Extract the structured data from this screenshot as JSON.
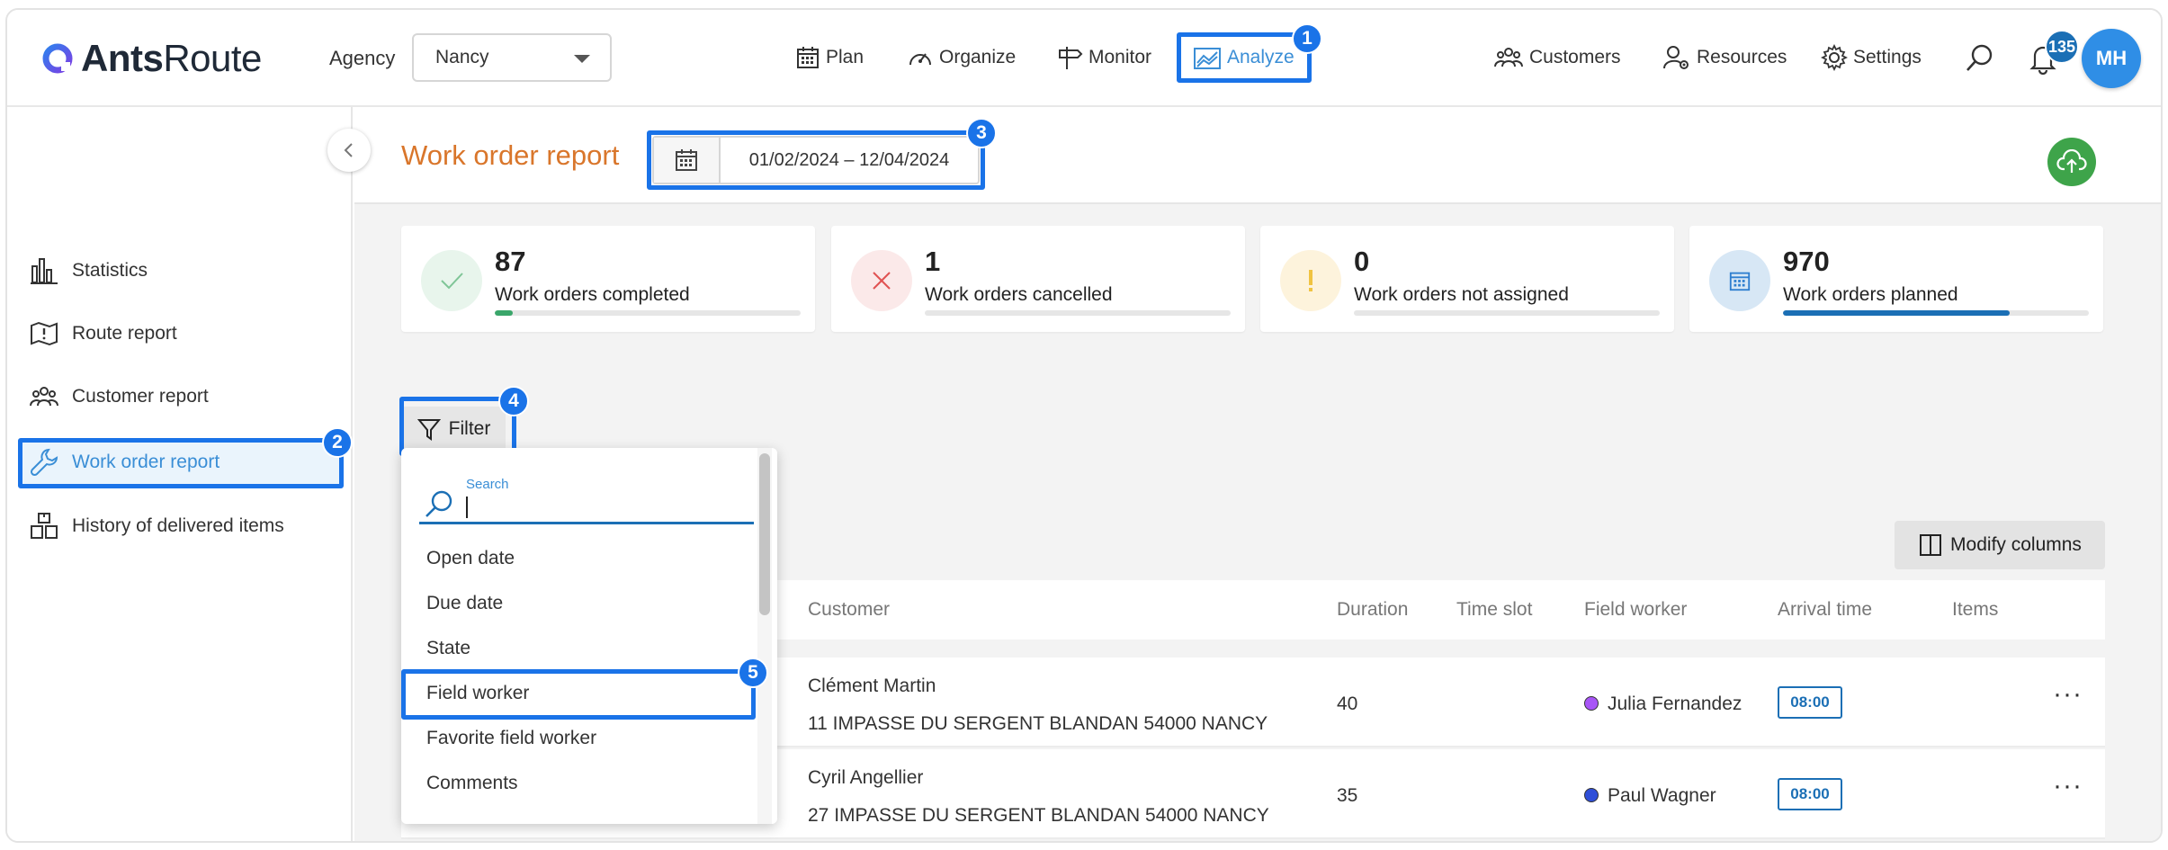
{
  "app": {
    "logo_text_bold": "Ants",
    "logo_text_light": "Route"
  },
  "header": {
    "agency_label": "Agency",
    "agency_value": "Nancy",
    "nav": [
      {
        "label": "Plan",
        "icon": "calendar-icon"
      },
      {
        "label": "Organize",
        "icon": "gauge-icon"
      },
      {
        "label": "Monitor",
        "icon": "signpost-icon"
      },
      {
        "label": "Analyze",
        "icon": "chart-icon",
        "active": true
      }
    ],
    "right_nav": [
      {
        "label": "Customers",
        "icon": "people-icon"
      },
      {
        "label": "Resources",
        "icon": "user-gear-icon"
      },
      {
        "label": "Settings",
        "icon": "gear-icon"
      }
    ],
    "notifications_count": "135",
    "avatar_initials": "MH"
  },
  "sidebar": {
    "items": [
      {
        "label": "Statistics",
        "icon": "bar-chart-icon"
      },
      {
        "label": "Route report",
        "icon": "route-icon"
      },
      {
        "label": "Customer report",
        "icon": "people-icon"
      },
      {
        "label": "Work order report",
        "icon": "wrench-icon",
        "active": true
      },
      {
        "label": "History of delivered items",
        "icon": "boxes-icon"
      }
    ]
  },
  "page": {
    "title": "Work order report",
    "date_range": "01/02/2024 – 12/04/2024"
  },
  "stats": [
    {
      "value": "87",
      "label": "Work orders completed",
      "fill": 0.06,
      "color": "#3aa66a"
    },
    {
      "value": "1",
      "label": "Work orders cancelled",
      "fill": 0.0,
      "color": "#e05252"
    },
    {
      "value": "0",
      "label": "Work orders not assigned",
      "fill": 0.0,
      "color": "#e8b23a"
    },
    {
      "value": "970",
      "label": "Work orders planned",
      "fill": 0.74,
      "color": "#1b6fb5"
    }
  ],
  "toolbar": {
    "filter_label": "Filter",
    "modify_columns_label": "Modify columns"
  },
  "filter_dropdown": {
    "search_label": "Search",
    "items": [
      "Open date",
      "Due date",
      "State",
      "Field worker",
      "Favorite field worker",
      "Comments"
    ]
  },
  "table": {
    "headers": [
      "Customer",
      "Duration",
      "Time slot",
      "Field worker",
      "Arrival time",
      "Items"
    ],
    "rows": [
      {
        "customer": "Clément Martin",
        "address": "11 IMPASSE DU SERGENT BLANDAN 54000 NANCY",
        "duration": "40",
        "worker": "Julia Fernandez",
        "worker_color": "#a855f7",
        "arrival": "08:00"
      },
      {
        "customer": "Cyril Angellier",
        "address": "27 IMPASSE DU SERGENT BLANDAN 54000 NANCY",
        "duration": "35",
        "worker": "Paul Wagner",
        "worker_color": "#2f4fd8",
        "arrival": "08:00"
      }
    ]
  },
  "annotations": [
    "1",
    "2",
    "3",
    "4",
    "5"
  ],
  "colors": {
    "accent": "#1a73e8",
    "title": "#d9762b",
    "analyze": "#3a8ed6",
    "cloud": "#3ea44a"
  }
}
